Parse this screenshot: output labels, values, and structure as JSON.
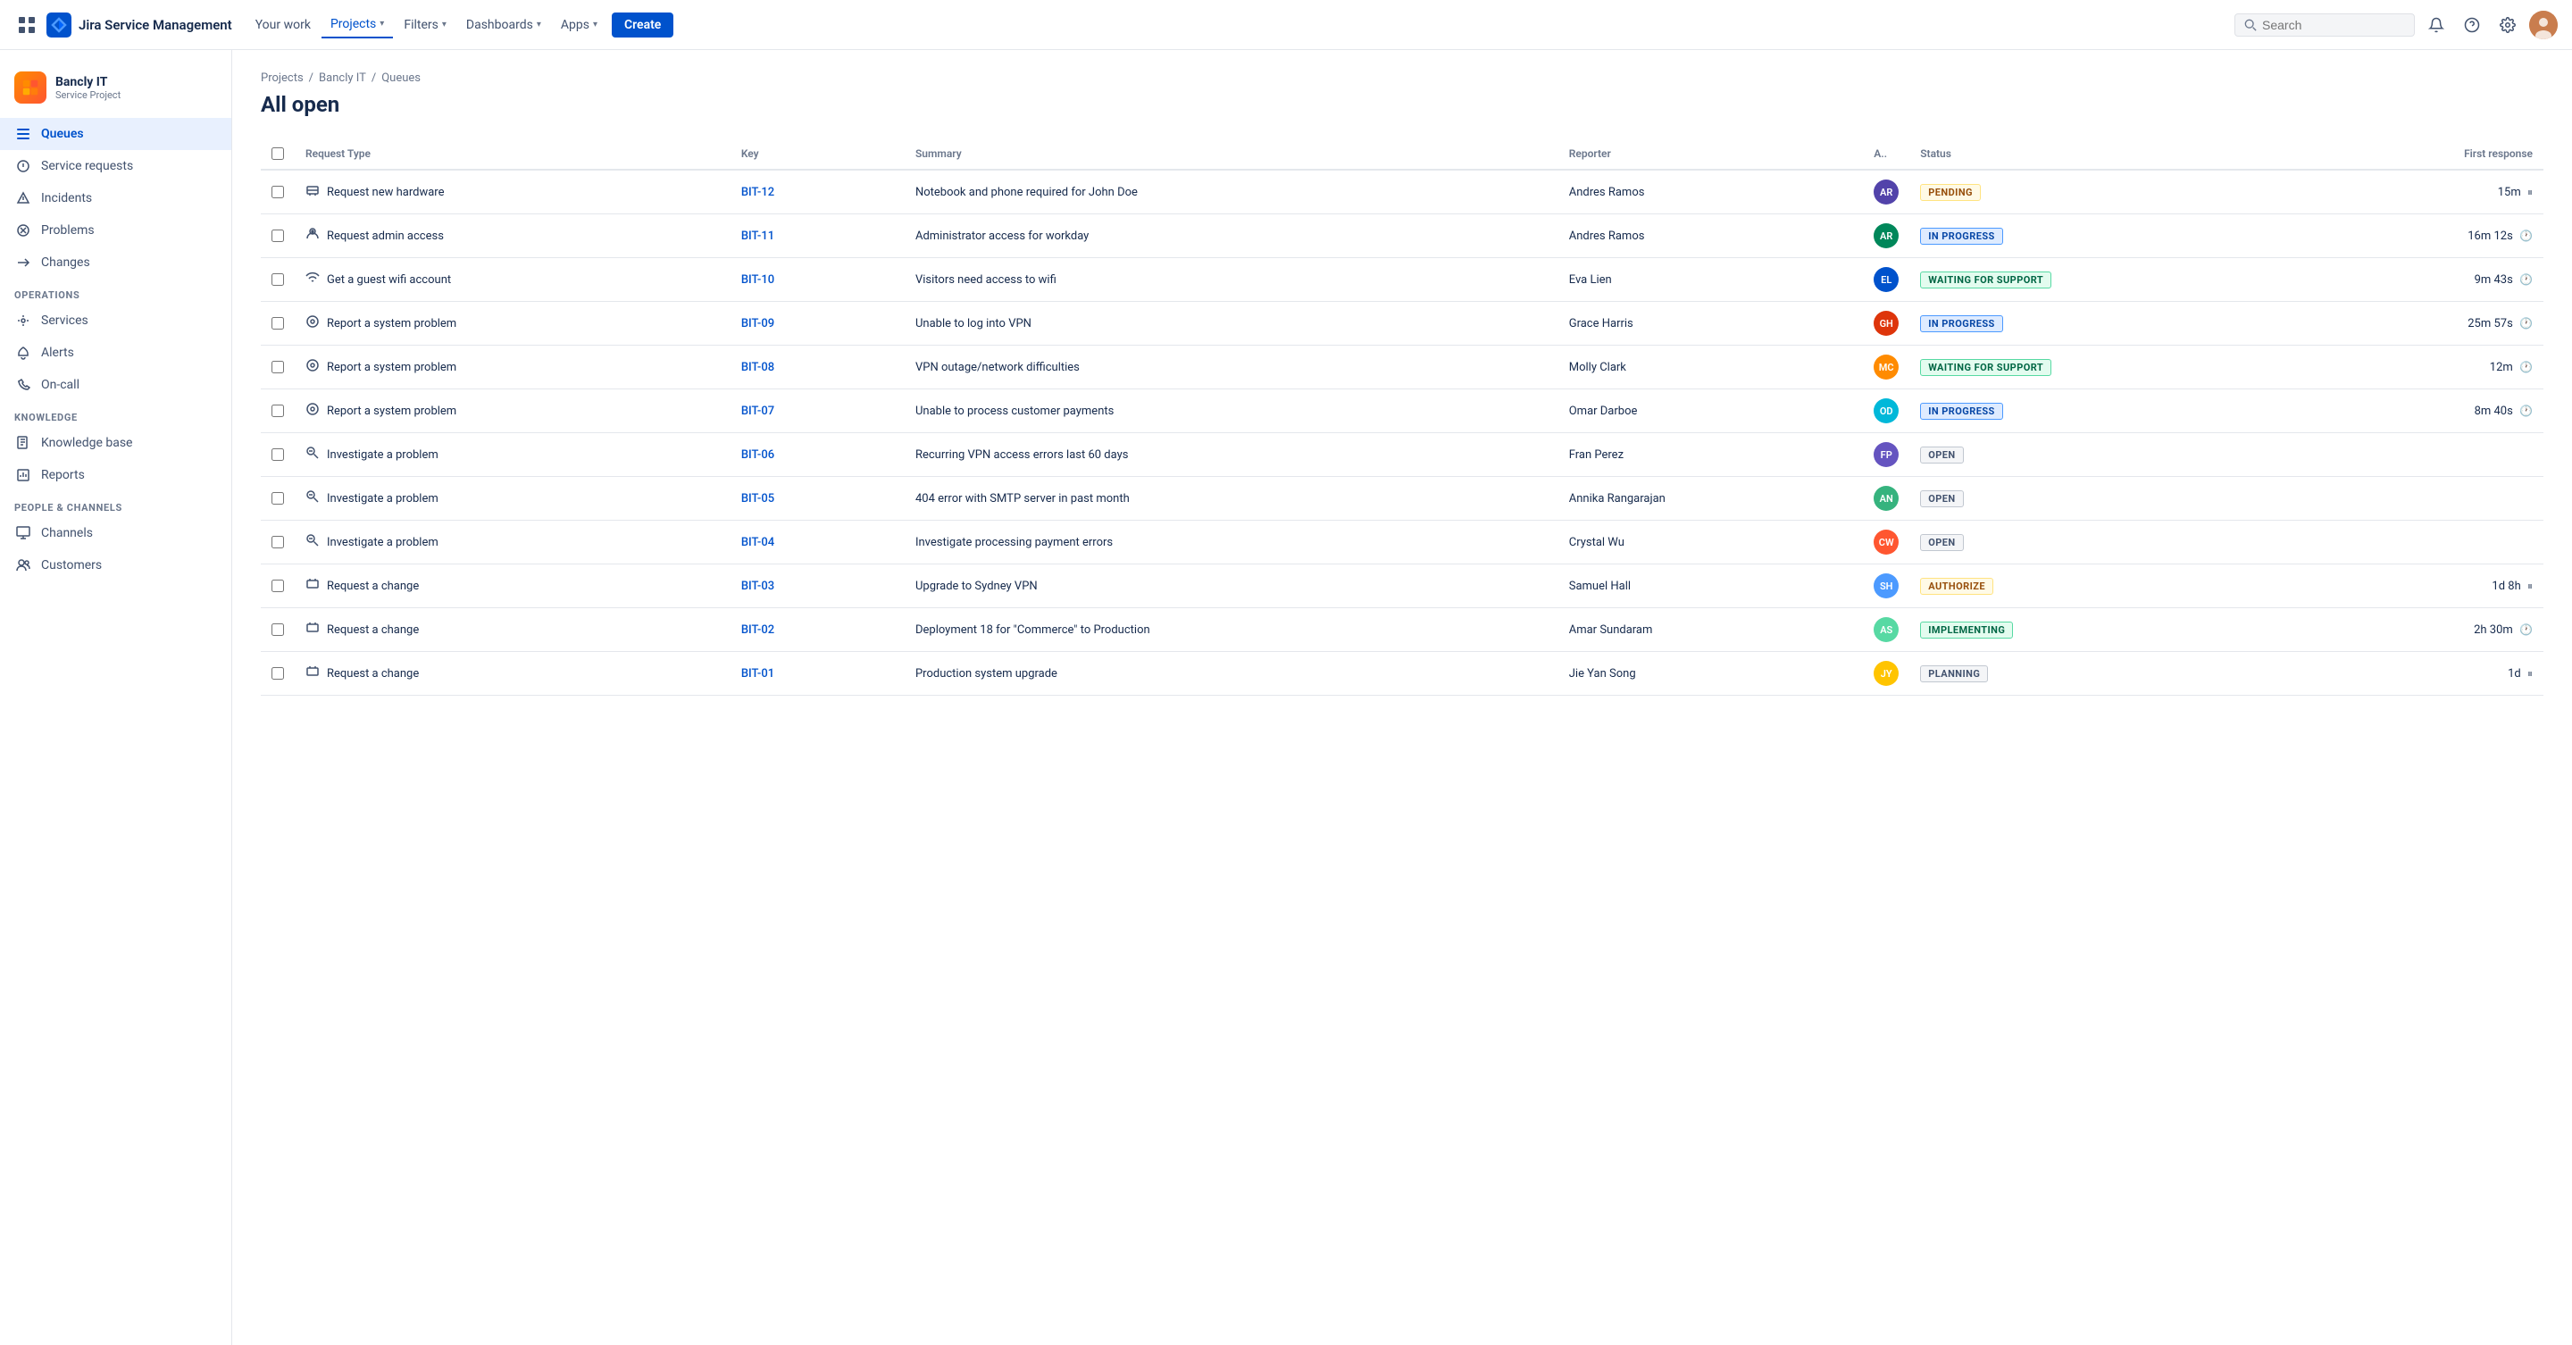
{
  "topnav": {
    "logo_text": "Jira Service Management",
    "nav_items": [
      {
        "label": "Your work",
        "active": false,
        "has_chevron": false
      },
      {
        "label": "Projects",
        "active": true,
        "has_chevron": true
      },
      {
        "label": "Filters",
        "active": false,
        "has_chevron": true
      },
      {
        "label": "Dashboards",
        "active": false,
        "has_chevron": true
      },
      {
        "label": "Apps",
        "active": false,
        "has_chevron": true
      }
    ],
    "create_label": "Create",
    "search_placeholder": "Search"
  },
  "sidebar": {
    "project_name": "Bancly IT",
    "project_type": "Service Project",
    "nav": [
      {
        "label": "Queues",
        "active": true,
        "icon": "queues"
      },
      {
        "label": "Service requests",
        "active": false,
        "icon": "service-requests"
      },
      {
        "label": "Incidents",
        "active": false,
        "icon": "incidents"
      },
      {
        "label": "Problems",
        "active": false,
        "icon": "problems"
      },
      {
        "label": "Changes",
        "active": false,
        "icon": "changes"
      }
    ],
    "sections": [
      {
        "label": "Operations",
        "items": [
          {
            "label": "Services",
            "icon": "services"
          },
          {
            "label": "Alerts",
            "icon": "alerts"
          },
          {
            "label": "On-call",
            "icon": "on-call"
          }
        ]
      },
      {
        "label": "Knowledge",
        "items": [
          {
            "label": "Knowledge base",
            "icon": "knowledge-base"
          },
          {
            "label": "Reports",
            "icon": "reports"
          }
        ]
      },
      {
        "label": "People & Channels",
        "items": [
          {
            "label": "Channels",
            "icon": "channels"
          },
          {
            "label": "Customers",
            "icon": "customers"
          }
        ]
      }
    ]
  },
  "breadcrumb": [
    "Projects",
    "Bancly IT",
    "Queues"
  ],
  "page_title": "All open",
  "table": {
    "columns": [
      "",
      "Request Type",
      "Key",
      "Summary",
      "Reporter",
      "A..",
      "Status",
      "First response"
    ],
    "rows": [
      {
        "type": "Request new hardware",
        "type_icon": "hardware",
        "key": "BIT-12",
        "summary": "Notebook and phone required for John Doe",
        "reporter": "Andres Ramos",
        "assignee_initials": "AR",
        "assignee_color": "av-1",
        "status": "PENDING",
        "status_class": "status-pending",
        "first_response": "15m",
        "first_response_icon": "pause"
      },
      {
        "type": "Request admin access",
        "type_icon": "admin",
        "key": "BIT-11",
        "summary": "Administrator access for workday",
        "reporter": "Andres Ramos",
        "assignee_initials": "AR",
        "assignee_color": "av-2",
        "status": "IN PROGRESS",
        "status_class": "status-in-progress",
        "first_response": "16m 12s",
        "first_response_icon": "clock"
      },
      {
        "type": "Get a guest wifi account",
        "type_icon": "wifi",
        "key": "BIT-10",
        "summary": "Visitors need access to wifi",
        "reporter": "Eva Lien",
        "assignee_initials": "EL",
        "assignee_color": "av-3",
        "status": "WAITING FOR SUPPORT",
        "status_class": "status-waiting",
        "first_response": "9m 43s",
        "first_response_icon": "clock"
      },
      {
        "type": "Report a system problem",
        "type_icon": "system",
        "key": "BIT-09",
        "summary": "Unable to log into VPN",
        "reporter": "Grace Harris",
        "assignee_initials": "GH",
        "assignee_color": "av-4",
        "status": "IN PROGRESS",
        "status_class": "status-in-progress",
        "first_response": "25m 57s",
        "first_response_icon": "clock"
      },
      {
        "type": "Report a system problem",
        "type_icon": "system",
        "key": "BIT-08",
        "summary": "VPN outage/network difficulties",
        "reporter": "Molly Clark",
        "assignee_initials": "MC",
        "assignee_color": "av-5",
        "status": "WAITING FOR SUPPORT",
        "status_class": "status-waiting",
        "first_response": "12m",
        "first_response_icon": "clock"
      },
      {
        "type": "Report a system problem",
        "type_icon": "system",
        "key": "BIT-07",
        "summary": "Unable to process customer payments",
        "reporter": "Omar Darboe",
        "assignee_initials": "OD",
        "assignee_color": "av-6",
        "status": "IN PROGRESS",
        "status_class": "status-in-progress",
        "first_response": "8m 40s",
        "first_response_icon": "clock"
      },
      {
        "type": "Investigate a problem",
        "type_icon": "investigate",
        "key": "BIT-06",
        "summary": "Recurring VPN access errors last 60 days",
        "reporter": "Fran Perez",
        "assignee_initials": "FP",
        "assignee_color": "av-7",
        "status": "OPEN",
        "status_class": "status-open",
        "first_response": "",
        "first_response_icon": ""
      },
      {
        "type": "Investigate a problem",
        "type_icon": "investigate",
        "key": "BIT-05",
        "summary": "404 error with SMTP server in past month",
        "reporter": "Annika Rangarajan",
        "assignee_initials": "AN",
        "assignee_color": "av-8",
        "status": "OPEN",
        "status_class": "status-open",
        "first_response": "",
        "first_response_icon": ""
      },
      {
        "type": "Investigate a problem",
        "type_icon": "investigate",
        "key": "BIT-04",
        "summary": "Investigate processing payment errors",
        "reporter": "Crystal Wu",
        "assignee_initials": "CW",
        "assignee_color": "av-9",
        "status": "OPEN",
        "status_class": "status-open",
        "first_response": "",
        "first_response_icon": ""
      },
      {
        "type": "Request a change",
        "type_icon": "change",
        "key": "BIT-03",
        "summary": "Upgrade to Sydney VPN",
        "reporter": "Samuel Hall",
        "assignee_initials": "SH",
        "assignee_color": "av-10",
        "status": "AUTHORIZE",
        "status_class": "status-authorize",
        "first_response": "1d 8h",
        "first_response_icon": "pause"
      },
      {
        "type": "Request a change",
        "type_icon": "change",
        "key": "BIT-02",
        "summary": "Deployment 18 for \"Commerce\" to Production",
        "reporter": "Amar Sundaram",
        "assignee_initials": "AS",
        "assignee_color": "av-11",
        "status": "IMPLEMENTING",
        "status_class": "status-implementing",
        "first_response": "2h 30m",
        "first_response_icon": "clock"
      },
      {
        "type": "Request a change",
        "type_icon": "change",
        "key": "BIT-01",
        "summary": "Production system upgrade",
        "reporter": "Jie Yan Song",
        "assignee_initials": "JY",
        "assignee_color": "av-12",
        "status": "PLANNING",
        "status_class": "status-planning",
        "first_response": "1d",
        "first_response_icon": "pause"
      }
    ]
  }
}
